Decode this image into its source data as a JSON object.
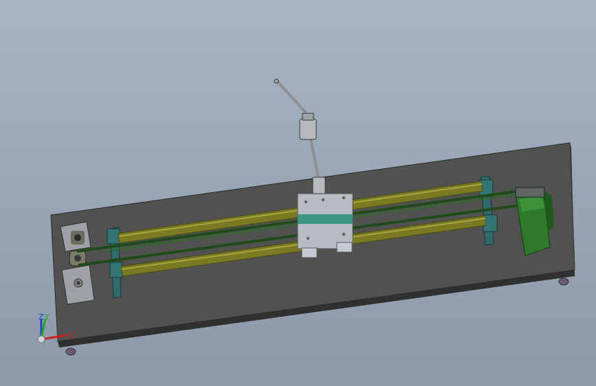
{
  "viewport": {
    "background_top": "#a9b5c4",
    "background_bottom": "#8d99a9"
  },
  "model": {
    "plate_color": "#4a4b4a",
    "rod_color": "#7a7a22",
    "belt_color": "#1f4a1a",
    "bracket_color": "#2f6b6b",
    "motor_color": "#2f7a2a",
    "slider_color": "#b9bcc2",
    "slider_teeth_color": "#2a8f7a"
  },
  "triad": {
    "x_label": "X",
    "y_label": "Y",
    "z_label": "Z",
    "x_color": "#cc1e1e",
    "y_color": "#22aa22",
    "z_color": "#2244cc"
  }
}
